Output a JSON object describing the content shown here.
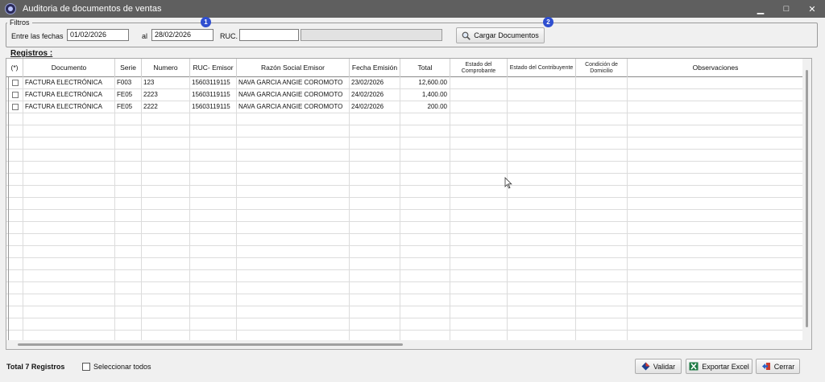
{
  "window": {
    "title": "Auditoria de documentos  de ventas",
    "minimize": "▁",
    "maximize": "□",
    "close": "✕"
  },
  "filters": {
    "legend": "Filtros",
    "from_label": "Entre las fechas",
    "from_value": "01/02/2026",
    "to_label": "al",
    "to_value": "28/02/2026",
    "ruc_label": "RUC.",
    "ruc_value": "",
    "ruc_name_value": "",
    "load_button": "Cargar Documentos",
    "badge_1": "1",
    "badge_2": "2"
  },
  "grid": {
    "label": "Registros :",
    "columns": [
      "(*)",
      "Documento",
      "Serie",
      "Numero",
      "RUC- Emisor",
      "Razón Social Emisor",
      "Fecha Emisión",
      "Total",
      "Estado del Comprobante",
      "Estado del Contribuyente",
      "Condición de Domicilio",
      "Observaciones"
    ],
    "rows": [
      [
        "",
        "FACTURA ELECTRÓNICA",
        "F003",
        "123",
        "15603119115",
        "NAVA GARCIA ANGIE COROMOTO",
        "23/02/2026",
        "12,600.00",
        "",
        "",
        "",
        ""
      ],
      [
        "",
        "FACTURA ELECTRÓNICA",
        "FE05",
        "2223",
        "15603119115",
        "NAVA GARCIA ANGIE COROMOTO",
        "24/02/2026",
        "1,400.00",
        "",
        "",
        "",
        ""
      ],
      [
        "",
        "FACTURA ELECTRÓNICA",
        "FE05",
        "2222",
        "15603119115",
        "NAVA GARCIA ANGIE COROMOTO",
        "24/02/2026",
        "200.00",
        "",
        "",
        "",
        ""
      ]
    ]
  },
  "footer": {
    "total": "Total 7 Registros",
    "select_all": "Seleccionar todos",
    "validate": "Validar",
    "export": "Exportar Excel",
    "close": "Cerrar"
  },
  "icons": {
    "app": "app-logo-icon",
    "load": "magnifier-icon",
    "validate": "diamond-validate-icon",
    "export": "excel-icon",
    "close": "exit-arrow-icon"
  }
}
